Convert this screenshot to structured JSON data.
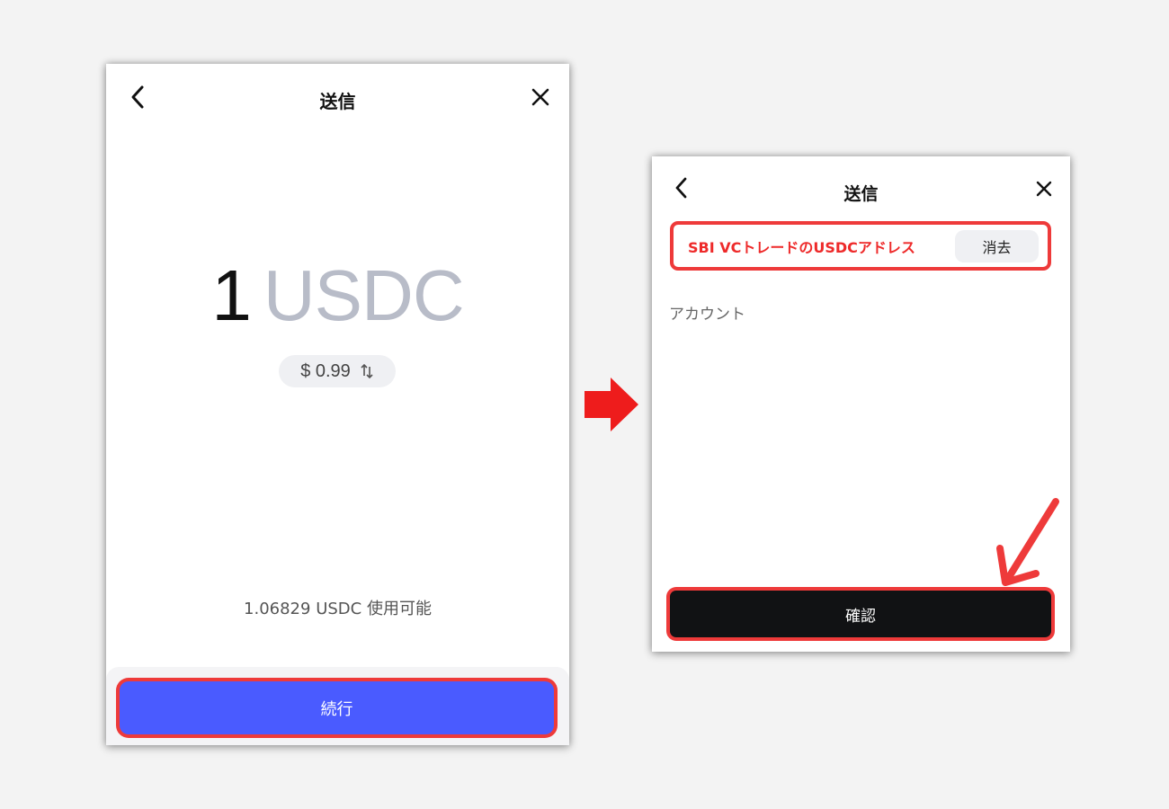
{
  "colors": {
    "background": "#f3f3f3",
    "highlight": "#ee3a3a",
    "continue_button": "#4a5bff",
    "confirm_button": "#111214",
    "unit_text": "#b8bcc8"
  },
  "left_screen": {
    "title": "送信",
    "back_icon": "chevron-left-icon",
    "close_icon": "close-icon",
    "amount": {
      "value": "1",
      "unit": "USDC"
    },
    "fiat": {
      "value": "$ 0.99",
      "swap_icon": "swap-vertical-icon"
    },
    "available_text": "1.06829 USDC 使用可能",
    "continue_label": "続行"
  },
  "right_screen": {
    "title": "送信",
    "back_icon": "chevron-left-icon",
    "close_icon": "close-icon",
    "address_text": "SBI VCトレードのUSDCアドレス",
    "clear_label": "消去",
    "account_label": "アカウント",
    "confirm_label": "確認"
  },
  "annotations": {
    "transition_arrow": "arrow-right-icon",
    "pointer_arrow": "arrow-down-left-icon"
  }
}
